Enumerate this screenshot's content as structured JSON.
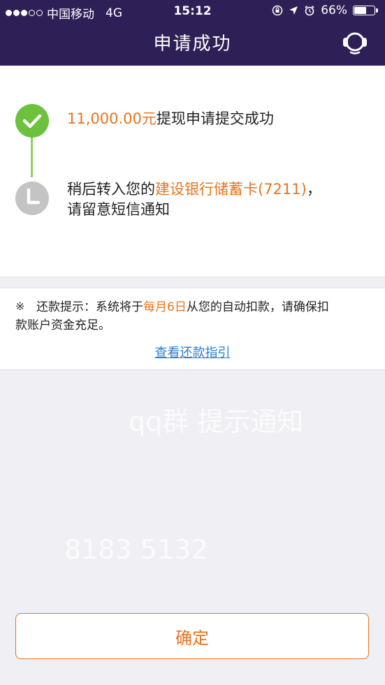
{
  "status_bar": {
    "carrier": "中国移动",
    "network": "4G",
    "time": "15:12",
    "battery": "66%",
    "battery_level": 0.66
  },
  "nav": {
    "title": "申请成功",
    "right_icon": "customer-service-icon"
  },
  "steps": [
    {
      "state": "done",
      "icon": "check-icon",
      "amount": "11,000.00元",
      "text": "提现申请提交成功"
    },
    {
      "state": "pending",
      "icon": "clock-icon",
      "text_before": "稍后转入您的",
      "bank": "建设银行储蓄卡(7211)",
      "text_after": "，",
      "line2": "请留意短信通知"
    }
  ],
  "notice": {
    "mark": "※",
    "prefix": "还款提示：系统将于",
    "date": "每月6日",
    "suffix": "从您的自动扣款，请确保扣",
    "line2": "款账户资金充足。",
    "link": "查看还款指引"
  },
  "watermarks": [
    "qq群 提示通知",
    "8183 5132"
  ],
  "confirm_label": "确定",
  "colors": {
    "nav_bg": "#2e2056",
    "accent": "#e7741c",
    "success": "#6cc13d",
    "pending": "#c4c4c4",
    "link": "#2a7fd4",
    "page_bg": "#efeff4"
  }
}
